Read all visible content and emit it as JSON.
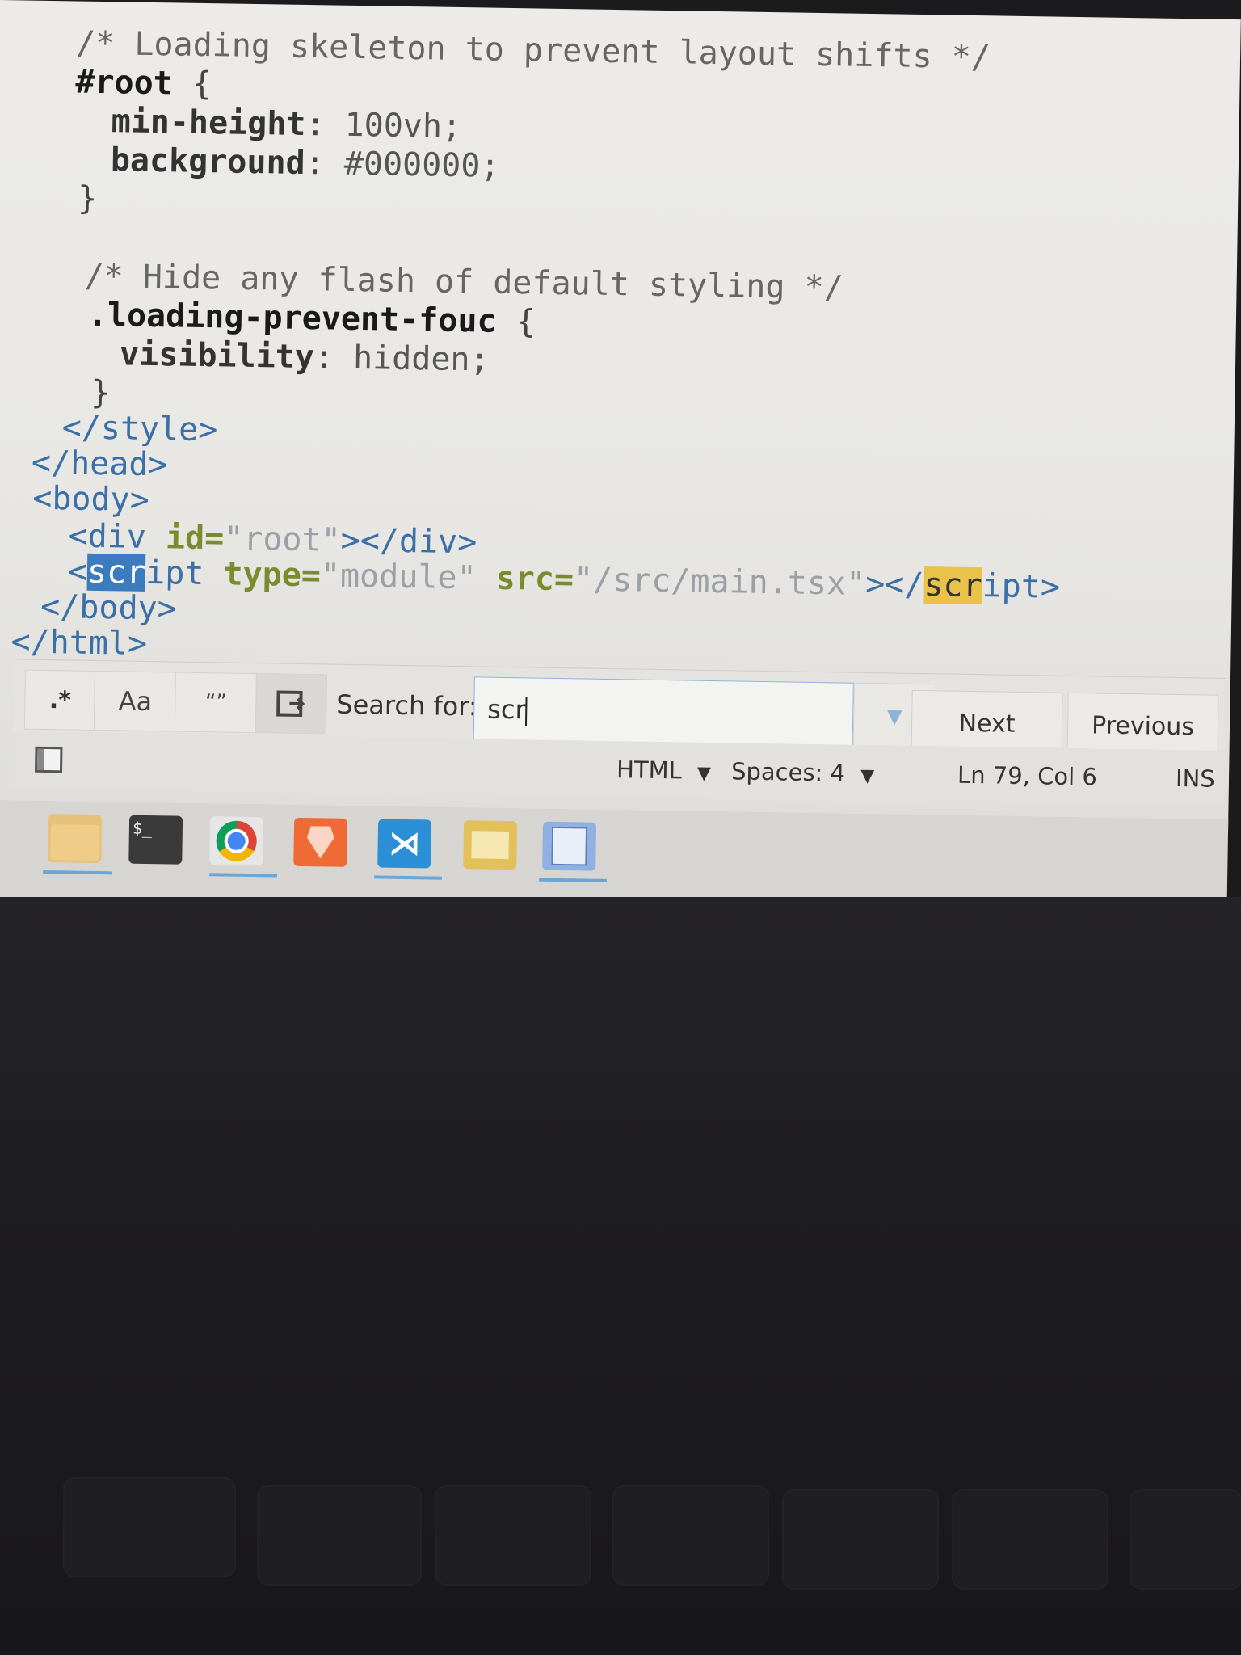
{
  "editor": {
    "lines": [
      {
        "parts": [
          {
            "cls": "cmt",
            "text": "/* Loading skeleton to prevent layout shifts */"
          }
        ]
      },
      {
        "parts": [
          {
            "cls": "sel",
            "text": "#root"
          },
          {
            "cls": "punct",
            "text": " {"
          }
        ]
      },
      {
        "parts": [
          {
            "cls": "prop",
            "text": "min-height"
          },
          {
            "cls": "punct",
            "text": ": "
          },
          {
            "cls": "val",
            "text": "100vh;"
          }
        ]
      },
      {
        "parts": [
          {
            "cls": "prop",
            "text": "background"
          },
          {
            "cls": "punct",
            "text": ": "
          },
          {
            "cls": "val",
            "text": "#000000;"
          }
        ]
      },
      {
        "parts": [
          {
            "cls": "punct",
            "text": "}"
          }
        ]
      },
      {
        "parts": [
          {
            "cls": "cmt",
            "text": "/* Hide any flash of default styling */"
          }
        ]
      },
      {
        "parts": [
          {
            "cls": "sel",
            "text": ".loading-prevent-fouc"
          },
          {
            "cls": "punct",
            "text": " {"
          }
        ]
      },
      {
        "parts": [
          {
            "cls": "prop",
            "text": "visibility"
          },
          {
            "cls": "punct",
            "text": ": "
          },
          {
            "cls": "val",
            "text": "hidden;"
          }
        ]
      },
      {
        "parts": [
          {
            "cls": "punct",
            "text": "}"
          }
        ]
      },
      {
        "parts": [
          {
            "cls": "tag",
            "text": "</style>"
          }
        ]
      },
      {
        "parts": [
          {
            "cls": "tag",
            "text": "</head>"
          }
        ]
      },
      {
        "parts": [
          {
            "cls": "tag",
            "text": "<body>"
          }
        ]
      },
      {
        "parts": [
          {
            "cls": "tag",
            "text": "<div "
          },
          {
            "cls": "attr",
            "text": "id="
          },
          {
            "cls": "str",
            "text": "\"root\""
          },
          {
            "cls": "tag",
            "text": "></div>"
          }
        ]
      },
      {
        "parts": [
          {
            "cls": "tag",
            "text": "<"
          },
          {
            "cls": "mcur",
            "text": "scr"
          },
          {
            "cls": "tag",
            "text": "ipt "
          },
          {
            "cls": "attr",
            "text": "type="
          },
          {
            "cls": "str",
            "text": "\"module\" "
          },
          {
            "cls": "attr",
            "text": "src="
          },
          {
            "cls": "str",
            "text": "\"/src/main.tsx\""
          },
          {
            "cls": "tag",
            "text": "></"
          },
          {
            "cls": "mhit",
            "text": "scr"
          },
          {
            "cls": "tag",
            "text": "ipt>"
          }
        ]
      },
      {
        "parts": [
          {
            "cls": "tag",
            "text": "</body>"
          }
        ]
      },
      {
        "parts": [
          {
            "cls": "tag",
            "text": "</html>"
          }
        ]
      }
    ]
  },
  "findbar": {
    "regex_label": ".*",
    "case_label": "Aa",
    "whole_word_label": "“”",
    "search_label": "Search for:",
    "search_value": "scr",
    "next_label": "Next",
    "previous_label": "Previous"
  },
  "statusbar": {
    "language": "HTML",
    "spaces": "Spaces: 4",
    "position": "Ln 79, Col 6",
    "mode": "INS"
  },
  "taskbar": {
    "apps": [
      {
        "name": "files-icon",
        "color": "#e6c27a"
      },
      {
        "name": "terminal-icon",
        "color": "#3a3a3a"
      },
      {
        "name": "chrome-icon",
        "color": "#4a8fd4"
      },
      {
        "name": "brave-icon",
        "color": "#f06a35"
      },
      {
        "name": "vscode-icon",
        "color": "#2a8fd6"
      },
      {
        "name": "notes-icon",
        "color": "#e2c15a"
      },
      {
        "name": "text-editor-icon",
        "color": "#8fb0e0"
      }
    ]
  }
}
